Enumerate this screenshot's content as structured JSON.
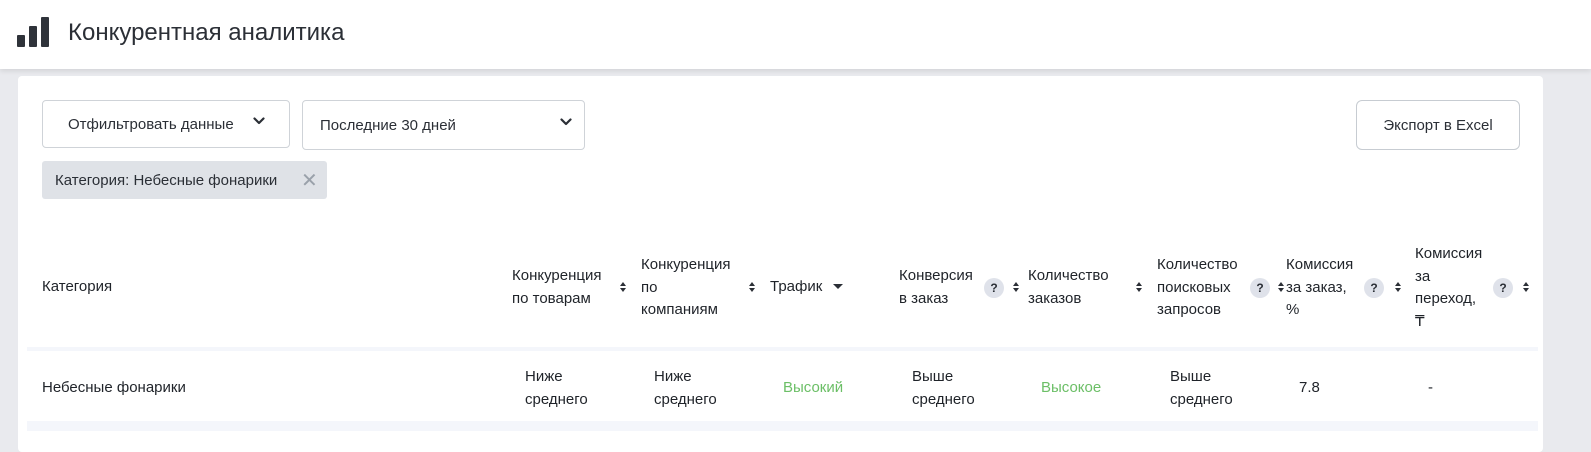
{
  "app": {
    "title": "Конкурентная аналитика",
    "icon": "bar-chart-icon"
  },
  "toolbar": {
    "filter_label": "Отфильтровать данные",
    "period_value": "Последние 30 дней",
    "export_label": "Экспорт в Excel"
  },
  "active_filter": {
    "label": "Категория: Небесные фонарики",
    "close_symbol": "✕"
  },
  "table": {
    "headers": {
      "category": "Категория",
      "comp_goods": [
        "Конкуренция",
        "по товарам"
      ],
      "comp_companies": [
        "Конкуренция",
        "по",
        "компаниям"
      ],
      "traffic": "Трафик",
      "conversion": [
        "Конверсия",
        "в заказ"
      ],
      "orders": [
        "Количество",
        "заказов"
      ],
      "searches": [
        "Количество",
        "поисковых",
        "запросов"
      ],
      "commission_order": [
        "Комиссия",
        "за заказ,",
        "%"
      ],
      "commission_click": [
        "Комиссия",
        "за",
        "переход,",
        "₸"
      ],
      "help_symbol": "?"
    },
    "rows": [
      {
        "category": "Небесные фонарики",
        "comp_goods": [
          "Ниже",
          "среднего"
        ],
        "comp_companies": [
          "Ниже",
          "среднего"
        ],
        "traffic": "Высокий",
        "conversion": [
          "Выше",
          "среднего"
        ],
        "orders": "Высокое",
        "searches": [
          "Выше",
          "среднего"
        ],
        "commission_order": "7.8",
        "commission_click": "-"
      }
    ]
  },
  "colors": {
    "positive": "#6cbf67",
    "page_bg": "#e9eaee",
    "chip_bg": "#dfe2e7"
  }
}
